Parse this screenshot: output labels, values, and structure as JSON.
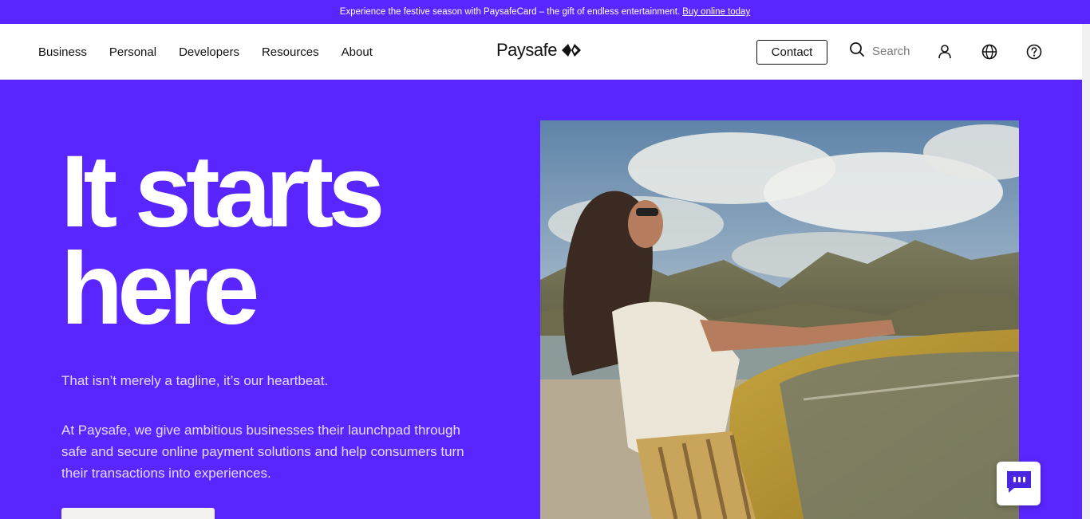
{
  "promo": {
    "text": "Experience the festive season with PaysafeCard – the gift of endless entertainment.",
    "link": "Buy online today"
  },
  "nav": {
    "items": [
      "Business",
      "Personal",
      "Developers",
      "Resources",
      "About"
    ]
  },
  "logo": {
    "text": "Paysafe",
    "icon": "paysafe-diamond-arrows-icon"
  },
  "header": {
    "contact_label": "Contact",
    "search_placeholder": "Search",
    "icons": [
      "search-icon",
      "user-icon",
      "globe-icon",
      "help-icon"
    ]
  },
  "hero": {
    "title_line1": "It starts",
    "title_line2": "here",
    "tagline": "That isn’t merely a tagline, it’s our heartbeat.",
    "description": "At Paysafe, we give ambitious businesses their launchpad through safe and secure online payment solutions and help consumers turn their transactions into experiences."
  },
  "chat": {
    "icon": "chat-bubble-icon"
  },
  "colors": {
    "brand_purple": "#5a26ff",
    "text_light": "#e4dcff",
    "white": "#ffffff"
  }
}
